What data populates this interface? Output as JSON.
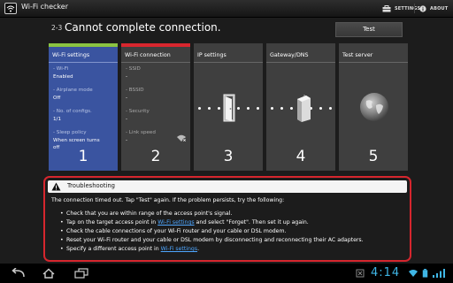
{
  "app": {
    "title": "Wi-Fi checker"
  },
  "actionbar": {
    "settings_label": "SETTINGS",
    "about_label": "ABOUT"
  },
  "heading": {
    "step": "2-3",
    "title": "Cannot complete connection.",
    "test_label": "Test"
  },
  "colors": {
    "card_selected": "#3a54a0",
    "bar_ok": "#8bc441",
    "bar_error": "#d8262e",
    "error_frame": "#d6262e",
    "link": "#4ea6ff",
    "clock": "#3fb6e6"
  },
  "cards": [
    {
      "name": "Wi-Fi settings",
      "number": "1",
      "status": "ok",
      "fields": [
        {
          "label": "- Wi-Fi",
          "value": "Enabled"
        },
        {
          "label": "- Airplane mode",
          "value": "Off"
        },
        {
          "label": "- No. of configs.",
          "value": "1/1"
        },
        {
          "label": "- Sleep policy",
          "value": "When screen turns",
          "value2": "off"
        }
      ]
    },
    {
      "name": "Wi-Fi connection",
      "number": "2",
      "status": "error",
      "fields": [
        {
          "label": "- SSID",
          "value": "-"
        },
        {
          "label": "- BSSID",
          "value": "-"
        },
        {
          "label": "- Security",
          "value": "-"
        },
        {
          "label": "- Link speed",
          "value": "-"
        }
      ]
    },
    {
      "name": "IP settings",
      "number": "3",
      "icon": "door-icon"
    },
    {
      "name": "Gateway/DNS",
      "number": "4",
      "icon": "router-icon"
    },
    {
      "name": "Test server",
      "number": "5",
      "icon": "globe-icon"
    }
  ],
  "troubleshooting": {
    "title": "Troubleshooting",
    "intro": "The connection timed out. Tap \"Test\" again. If the problem persists, try the following:",
    "items": [
      {
        "text": "Check that you are within range of the access point's signal."
      },
      {
        "pre": "Tap on the target access point in ",
        "link": "Wi-Fi settings",
        "post": " and select \"Forget\". Then set it up again."
      },
      {
        "text": "Check the cable connections of your Wi-Fi router and your cable or DSL modem."
      },
      {
        "text": "Reset your Wi-Fi router and your cable or DSL modem by disconnecting and reconnecting their AC adapters."
      },
      {
        "pre": "Specify a different access point in ",
        "link": "Wi-Fi settings",
        "post": "."
      }
    ]
  },
  "systembar": {
    "time": "4:14"
  }
}
